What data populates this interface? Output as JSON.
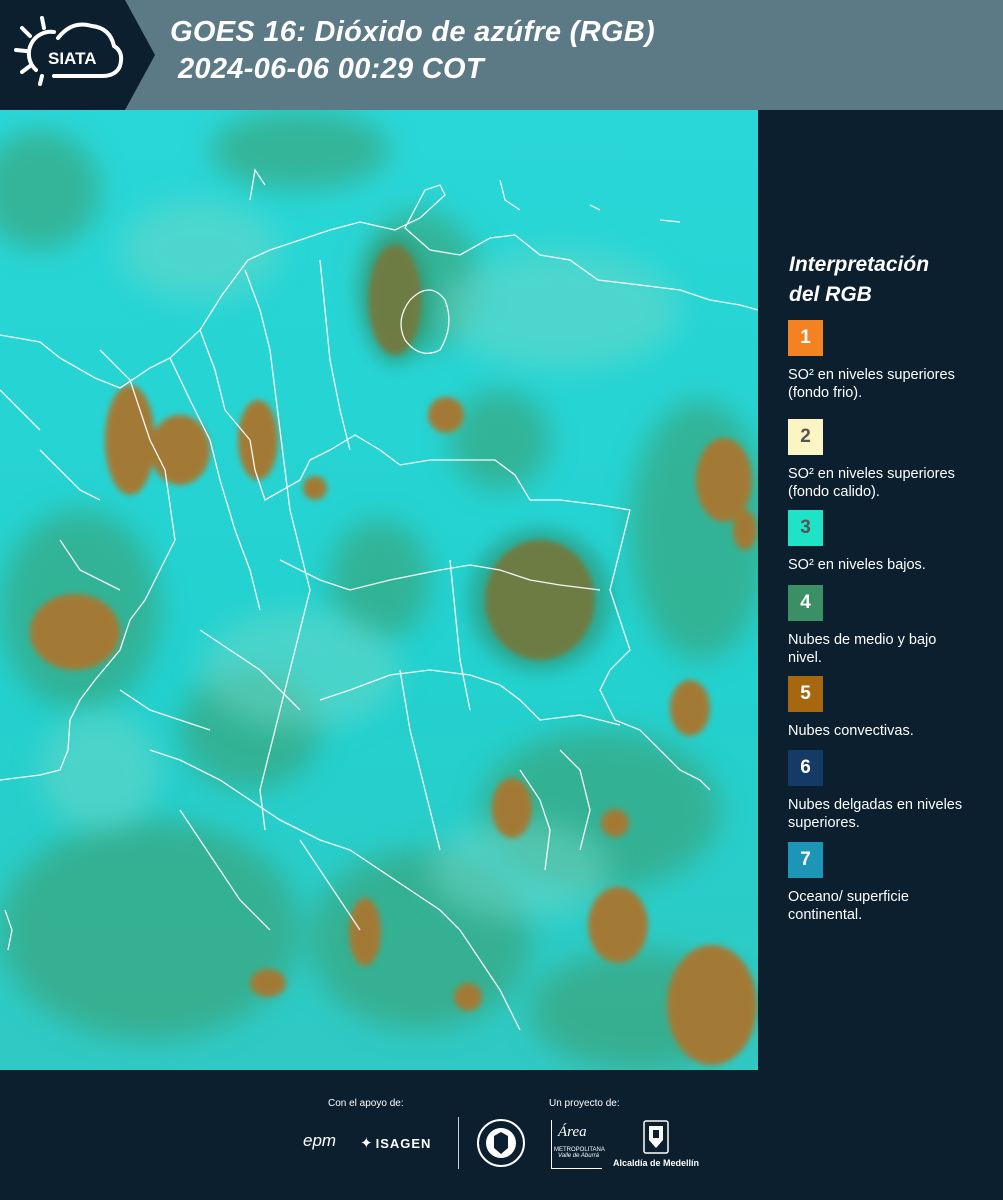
{
  "header": {
    "brand": "SIATA",
    "title_line1": "GOES 16: Dióxido de azúfre (RGB)",
    "title_line2": "2024-06-06 00:29 COT"
  },
  "legend": {
    "title_line1": "Interpretación",
    "title_line2": "del RGB",
    "items": [
      {
        "num": "1",
        "color": "#f58220",
        "text_color": "#ffffff",
        "desc": "SO² en niveles superiores (fondo frio)."
      },
      {
        "num": "2",
        "color": "#fbf5c4",
        "text_color": "#555555",
        "desc": "SO² en niveles superiores (fondo calido)."
      },
      {
        "num": "3",
        "color": "#1ee3c7",
        "text_color": "#555555",
        "desc": "SO² en niveles bajos."
      },
      {
        "num": "4",
        "color": "#3a8f64",
        "text_color": "#ffffff",
        "desc": "Nubes de medio y bajo nivel."
      },
      {
        "num": "5",
        "color": "#a7670f",
        "text_color": "#ffffff",
        "desc": "Nubes convectivas."
      },
      {
        "num": "6",
        "color": "#143a66",
        "text_color": "#ffffff",
        "desc": "Nubes delgadas en niveles superiores."
      },
      {
        "num": "7",
        "color": "#1c95b7",
        "text_color": "#ffffff",
        "desc": "Oceano/ superficie continental."
      }
    ]
  },
  "footer": {
    "support_label": "Con el apoyo de:",
    "project_label": "Un proyecto de:",
    "sponsor1": "epm",
    "sponsor2": "ISAGEN",
    "org_area_line1": "Área",
    "org_area_line2": "METROPOLITANA",
    "org_area_line3": "Valle de Aburrá",
    "org_alcaldia": "Alcaldía de Medellín"
  }
}
